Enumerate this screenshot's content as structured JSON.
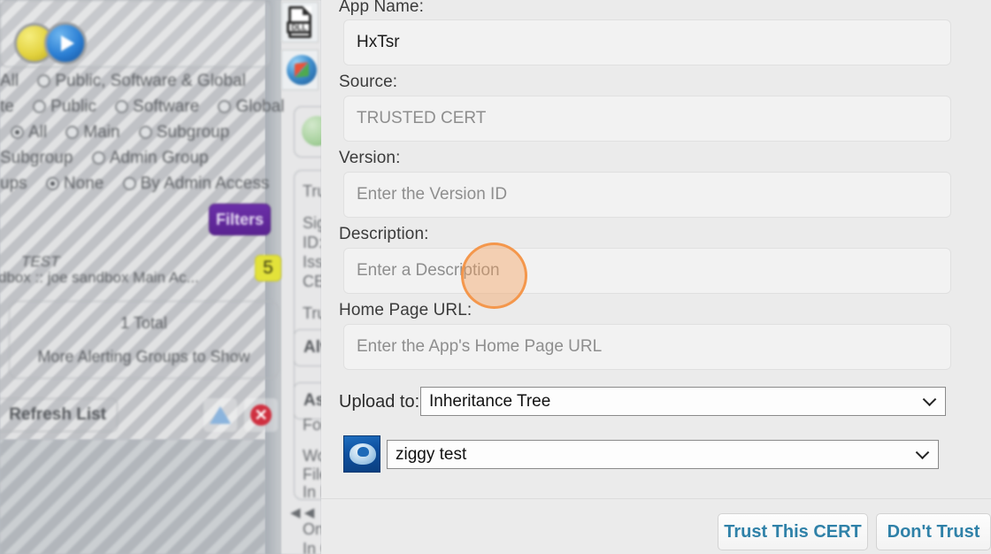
{
  "background": {
    "filters_panel": {
      "radio_groups": [
        {
          "prefix": "All",
          "options": [
            {
              "label": "Public, Software & Global",
              "selected": false
            }
          ]
        },
        {
          "prefix": "te",
          "options": [
            {
              "label": "Public",
              "selected": false
            },
            {
              "label": "Software",
              "selected": false
            },
            {
              "label": "Global",
              "selected": false
            }
          ]
        },
        {
          "prefix": "",
          "options": [
            {
              "label": "All",
              "selected": true
            },
            {
              "label": "Main",
              "selected": false
            },
            {
              "label": "Subgroup",
              "selected": false
            }
          ]
        },
        {
          "prefix": "Subgroup",
          "options": [
            {
              "label": "Admin Group",
              "selected": false
            }
          ]
        },
        {
          "prefix": "ups",
          "options": [
            {
              "label": "None",
              "selected": true
            },
            {
              "label": "By Admin Access",
              "selected": false
            }
          ]
        }
      ],
      "filters_button": "Filters",
      "test_row": {
        "title": "TEST",
        "subtitle": "dbox :: joe sandbox Main Ac...",
        "badge": "5"
      },
      "total_card": {
        "line1": "1 Total",
        "line2": "More Alerting Groups to Show"
      },
      "refresh_button": "Refresh List"
    },
    "middle_column": {
      "icons": [
        "dll-file-icon",
        "windows-logo-icon",
        "green-lock-icon"
      ],
      "text_lines": [
        "Trus",
        "Sigr",
        "ID: :",
        "Issu",
        "CEF",
        "Trus",
        "Workg",
        "File N",
        "In Dir",
        "On H",
        "In Gro"
      ],
      "buttons": [
        "Alv",
        "As"
      ],
      "for_label": "For"
    }
  },
  "dialog": {
    "fields": [
      {
        "label": "App Name:",
        "value": "HxTsr",
        "placeholder": "",
        "is_placeholder": false
      },
      {
        "label": "Source:",
        "value": "TRUSTED CERT",
        "placeholder": "",
        "is_placeholder": true
      },
      {
        "label": "Version:",
        "value": "Enter the Version ID",
        "placeholder": "Enter the Version ID",
        "is_placeholder": true
      },
      {
        "label": "Description:",
        "value": "Enter a Description",
        "placeholder": "Enter a Description",
        "is_placeholder": true
      },
      {
        "label": "Home Page URL:",
        "value": "Enter the App's Home Page URL",
        "placeholder": "Enter the App's Home Page URL",
        "is_placeholder": true
      }
    ],
    "upload_to": {
      "label": "Upload to:",
      "selected": "Inheritance Tree"
    },
    "group_select": {
      "selected": "ziggy test",
      "icon": "ziggy-cloud-icon"
    },
    "footer": {
      "primary_button": "Trust This CERT",
      "secondary_button": "Don't Trust"
    }
  },
  "colors": {
    "dialog_bg": "#ebebeb",
    "input_bg": "#f2f2f2",
    "button_text": "#2f81a8",
    "filters_purple": "#5a2391",
    "badge_yellow": "#e3e23a",
    "cursor_highlight": "#f39446"
  }
}
